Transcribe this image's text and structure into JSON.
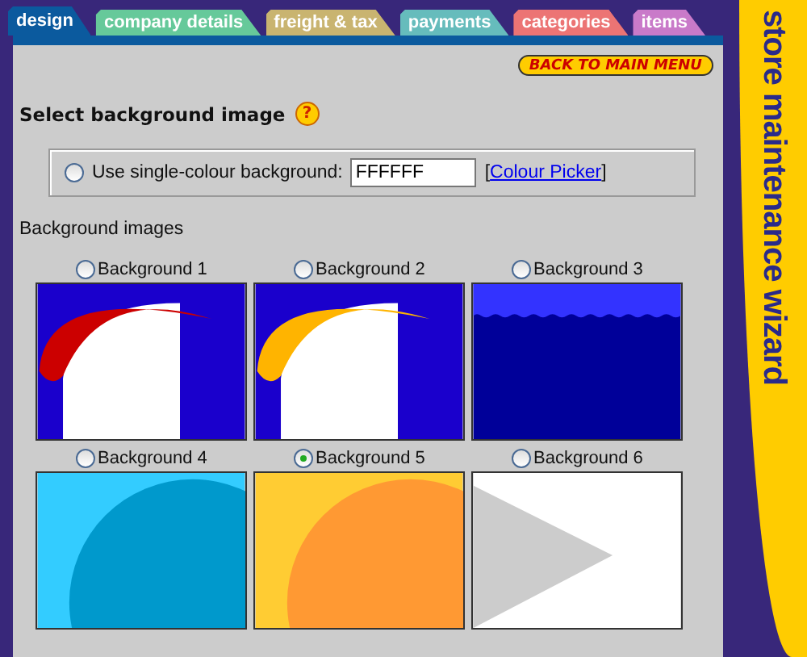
{
  "tabs": [
    {
      "label": "design",
      "color": "#0b5a9e",
      "selected": true
    },
    {
      "label": "company details",
      "color": "#66c99a",
      "selected": false
    },
    {
      "label": "freight & tax",
      "color": "#c9b470",
      "selected": false
    },
    {
      "label": "payments",
      "color": "#66bcbc",
      "selected": false
    },
    {
      "label": "categories",
      "color": "#ec7474",
      "selected": false
    },
    {
      "label": "items",
      "color": "#c97ac9",
      "selected": false
    }
  ],
  "back_button": "BACK TO MAIN MENU",
  "banner": "store maintenance wizard",
  "section_title": "Select background image",
  "help_icon": "?",
  "single_colour": {
    "label": "Use single-colour background:",
    "selected": false,
    "value": "FFFFFF",
    "link_open": "[",
    "link": "Colour Picker",
    "link_close": "]"
  },
  "images_heading": "Background images",
  "backgrounds": [
    {
      "label": "Background 1",
      "selected": false,
      "kind": "arch",
      "color": "#cc0000"
    },
    {
      "label": "Background 2",
      "selected": false,
      "kind": "arch",
      "color": "#ffb400"
    },
    {
      "label": "Background 3",
      "selected": false,
      "kind": "waves",
      "color": "#3333ff"
    },
    {
      "label": "Background 4",
      "selected": false,
      "kind": "circle",
      "color": "#33ccff"
    },
    {
      "label": "Background 5",
      "selected": true,
      "kind": "circle",
      "color": "#ffcc33"
    },
    {
      "label": "Background 6",
      "selected": false,
      "kind": "triangle",
      "color": "#cccccc"
    }
  ]
}
